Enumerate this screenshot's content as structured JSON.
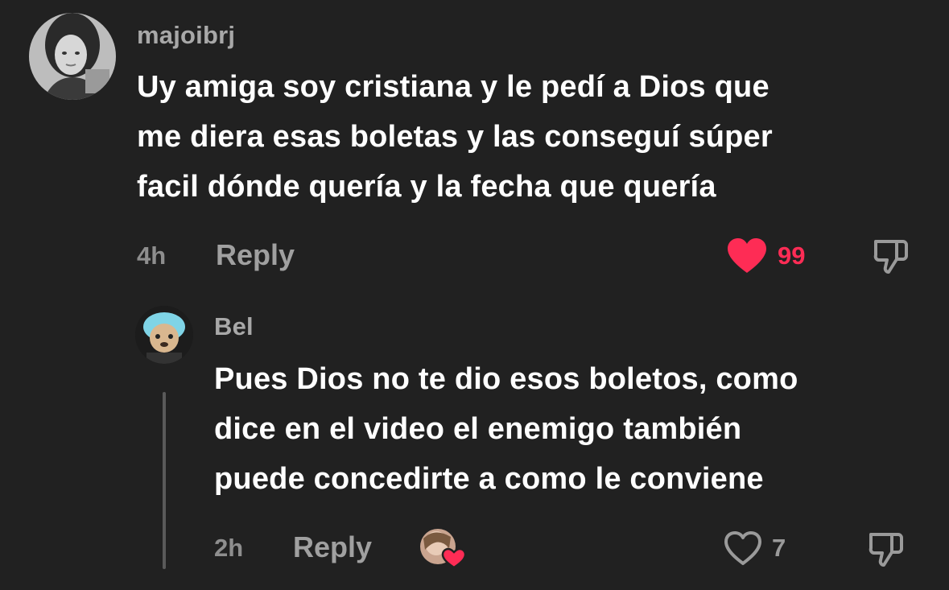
{
  "comments": [
    {
      "username": "majoibrj",
      "lines": [
        "Uy amiga soy cristiana y le pedí a Dios que",
        "me diera esas boletas y las conseguí súper",
        "facil dónde quería y la fecha que quería"
      ],
      "time": "4h",
      "reply_label": "Reply",
      "like_count": "99",
      "liked": true,
      "like_color": "#fe2c55"
    },
    {
      "username": "Bel",
      "lines": [
        "Pues Dios no te dio esos boletos, como",
        "dice en el video el enemigo también",
        "puede concedirte a como le conviene"
      ],
      "time": "2h",
      "reply_label": "Reply",
      "like_count": "7",
      "liked": false,
      "creator_liked": true
    }
  ],
  "icons": {
    "like": "heart-icon",
    "dislike": "thumbs-down-icon"
  }
}
